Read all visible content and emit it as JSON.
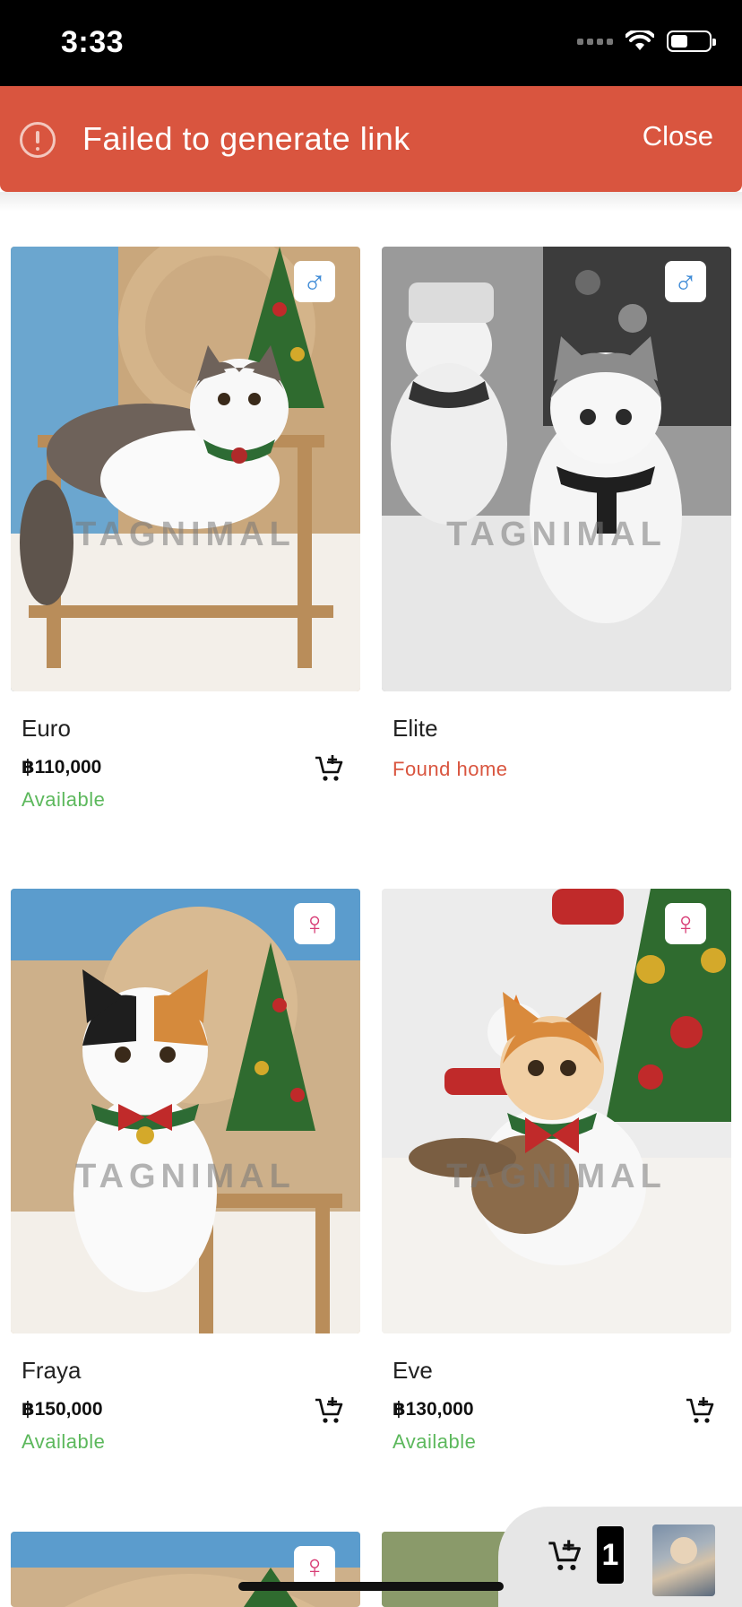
{
  "status_bar": {
    "time": "3:33",
    "icons": [
      "signal-icon",
      "wifi-icon",
      "battery-icon"
    ]
  },
  "banner": {
    "message": "Failed to generate link",
    "close_label": "Close",
    "icon": "alert-circle-icon",
    "color": "#d9553f"
  },
  "watermark_text": "TAGNIMAL",
  "pets": [
    {
      "name": "Euro",
      "price": "฿110,000",
      "status": "Available",
      "gender": "male",
      "gender_symbol": "♂"
    },
    {
      "name": "Elite",
      "price": "",
      "status": "Found home",
      "gender": "male",
      "gender_symbol": "♂"
    },
    {
      "name": "Fraya",
      "price": "฿150,000",
      "status": "Available",
      "gender": "female",
      "gender_symbol": "♀"
    },
    {
      "name": "Eve",
      "price": "฿130,000",
      "status": "Available",
      "gender": "female",
      "gender_symbol": "♀"
    },
    {
      "name": "",
      "price": "",
      "status": "",
      "gender": "female",
      "gender_symbol": "♀"
    }
  ],
  "floating_cart": {
    "count": "1",
    "icon": "cart-add-icon"
  },
  "colors": {
    "available": "#5cb85c",
    "found_home": "#d9553f",
    "male": "#3d8ad6",
    "female": "#d83d76"
  }
}
